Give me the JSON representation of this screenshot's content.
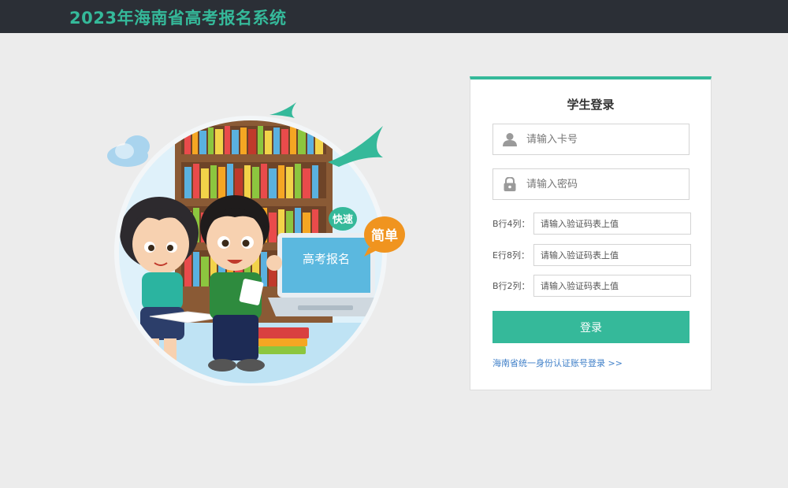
{
  "header": {
    "title": "2023年海南省高考报名系统"
  },
  "illustration": {
    "screen_text": "高考报名",
    "badge_fast": "快速",
    "badge_simple": "简单"
  },
  "login": {
    "title": "学生登录",
    "card_placeholder": "请输入卡号",
    "password_placeholder": "请输入密码",
    "codes": [
      {
        "label": "B行4列：",
        "placeholder": "请输入验证码表上值"
      },
      {
        "label": "E行8列：",
        "placeholder": "请输入验证码表上值"
      },
      {
        "label": "B行2列：",
        "placeholder": "请输入验证码表上值"
      }
    ],
    "submit_label": "登录",
    "id_login_link": "海南省统一身份认证账号登录 >>"
  },
  "colors": {
    "accent": "#35b99a",
    "header_bg": "#2b2f36",
    "link": "#3f7fc8",
    "badge_orange": "#f0941f"
  }
}
